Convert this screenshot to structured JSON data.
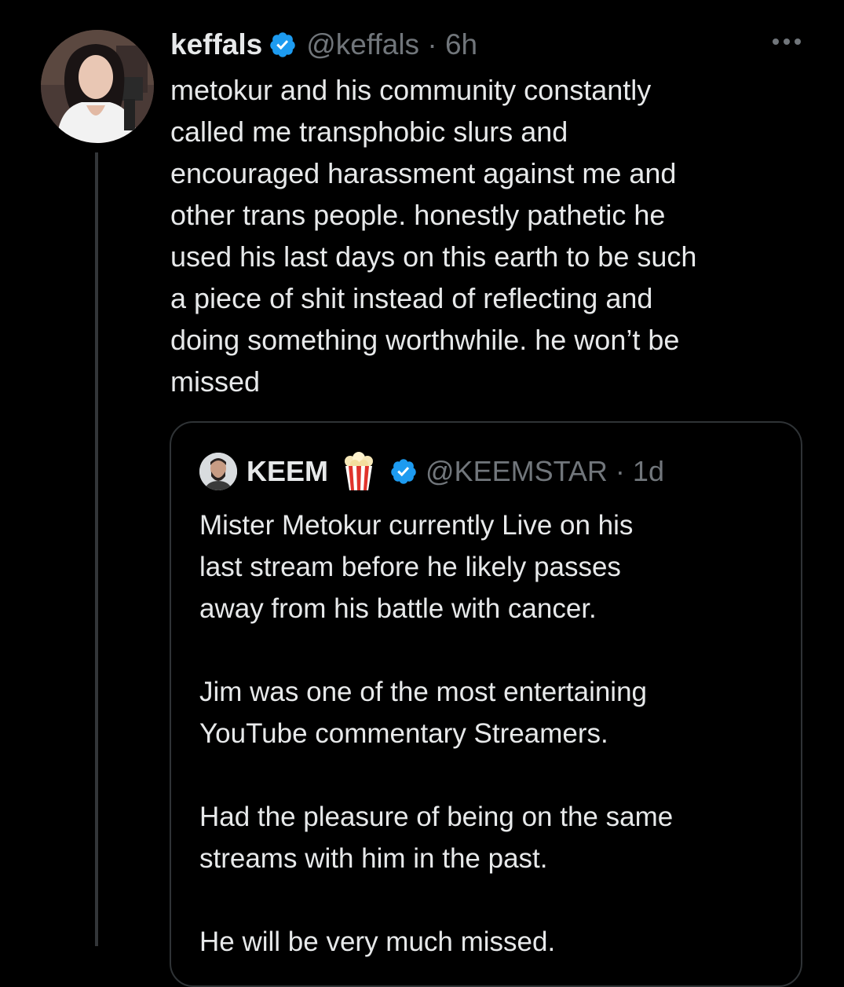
{
  "tweet": {
    "display_name": "keffals",
    "handle_time": "@keffals · 6h",
    "verified": true,
    "avatar_icon": "user-avatar",
    "more_icon": "more-options-icon",
    "text_lines": [
      "metokur and his community constantly",
      "called me transphobic slurs and",
      "encouraged harassment against me and",
      "other trans people. honestly pathetic he",
      "used his last days on this earth to be such",
      "a piece of shit instead of reflecting and",
      "doing something worthwhile. he won’t be",
      "missed"
    ]
  },
  "quote": {
    "display_name": "KEEM",
    "name_emoji": "popcorn-icon",
    "verified": true,
    "handle_time": "@KEEMSTAR · 1d",
    "text_lines": [
      "Mister Metokur currently Live on his",
      "last stream before he likely passes",
      "away from his battle with cancer.",
      "",
      "Jim was one of the most entertaining",
      "YouTube commentary Streamers.",
      "",
      "Had the pleasure of being on the same",
      "streams with him in the past.",
      "",
      "He will be very much missed."
    ]
  },
  "colors": {
    "background": "#000000",
    "text_primary": "#e7e9ea",
    "text_secondary": "#71767b",
    "verified_blue": "#1d9bf0",
    "border": "#2f3336"
  }
}
